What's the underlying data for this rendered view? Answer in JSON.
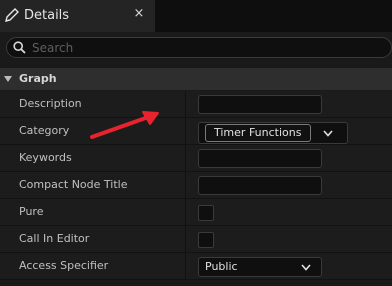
{
  "tab": {
    "title": "Details",
    "close_glyph": "×",
    "icon": "pencil-icon"
  },
  "search": {
    "placeholder": "Search",
    "value": "",
    "icon": "search-icon"
  },
  "section": {
    "title": "Graph",
    "expanded": true
  },
  "rows": [
    {
      "label": "Description",
      "control": "text",
      "value": ""
    },
    {
      "label": "Category",
      "control": "combo",
      "value": "Timer Functions"
    },
    {
      "label": "Keywords",
      "control": "text",
      "value": ""
    },
    {
      "label": "Compact Node Title",
      "control": "text",
      "value": ""
    },
    {
      "label": "Pure",
      "control": "checkbox",
      "checked": false
    },
    {
      "label": "Call In Editor",
      "control": "checkbox",
      "checked": false
    },
    {
      "label": "Access Specifier",
      "control": "combo",
      "value": "Public"
    }
  ],
  "colors": {
    "annotation_arrow": "#e8232d",
    "panel": "#1a1a1a",
    "section": "#2e2e2e"
  }
}
